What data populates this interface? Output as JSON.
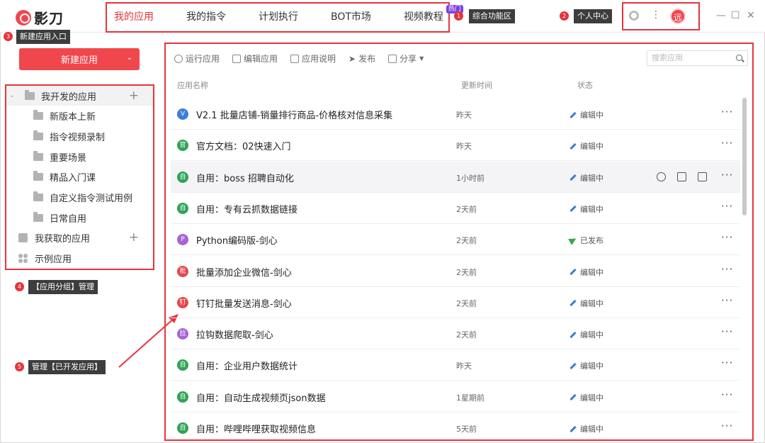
{
  "app": {
    "name": "影刀"
  },
  "nav": [
    {
      "label": "我的应用",
      "active": true
    },
    {
      "label": "我的指令"
    },
    {
      "label": "计划执行"
    },
    {
      "label": "BOT市场"
    },
    {
      "label": "视频教程",
      "badge": "热门"
    }
  ],
  "callouts": [
    {
      "num": "1",
      "label": "综合功能区"
    },
    {
      "num": "2",
      "label": "个人中心"
    },
    {
      "num": "3",
      "label": "新建应用入口"
    },
    {
      "num": "4",
      "label": "【应用分组】管理"
    },
    {
      "num": "5",
      "label": "管理【已开发应用】"
    }
  ],
  "user": {
    "avatar_text": "远"
  },
  "window_controls": {
    "minimize": "—",
    "maximize": "☐",
    "close": "✕"
  },
  "sidebar": {
    "new_button": "新建应用",
    "groups": [
      {
        "label": "我开发的应用",
        "expanded": true
      },
      {
        "label": "我获取的应用"
      },
      {
        "label": "示例应用"
      }
    ],
    "folders": [
      "新版本上新",
      "指令视频录制",
      "重要场景",
      "精品入门课",
      "自定义指令测试用例",
      "日常自用"
    ]
  },
  "toolbar": {
    "run": "运行应用",
    "edit": "编辑应用",
    "doc": "应用说明",
    "publish": "发布",
    "share": "分享"
  },
  "search": {
    "placeholder": "搜索应用"
  },
  "table": {
    "headers": {
      "name": "应用名称",
      "time": "更新时间",
      "status": "状态"
    },
    "rows": [
      {
        "badge": "V",
        "color": "#3b7ddd",
        "name": "V2.1 批量店铺-销量排行商品-价格核对信息采集",
        "time": "昨天",
        "status": "编辑中"
      },
      {
        "badge": "官",
        "color": "#2ea356",
        "name": "官方文档：02快速入门",
        "time": "昨天",
        "status": "编辑中"
      },
      {
        "badge": "自",
        "color": "#2ea356",
        "name": "自用：boss 招聘自动化",
        "time": "1小时前",
        "status": "编辑中"
      },
      {
        "badge": "自",
        "color": "#2ea356",
        "name": "自用：专有云抓数据链接",
        "time": "2天前",
        "status": "编辑中"
      },
      {
        "badge": "P",
        "color": "#a764d8",
        "name": "Python编码版-剑心",
        "time": "2天前",
        "status": "已发布"
      },
      {
        "badge": "批",
        "color": "#e5484d",
        "name": "批量添加企业微信-剑心",
        "time": "2天前",
        "status": "编辑中"
      },
      {
        "badge": "钉",
        "color": "#e5484d",
        "name": "钉钉批量发送消息-剑心",
        "time": "2天前",
        "status": "编辑中"
      },
      {
        "badge": "拉",
        "color": "#a764d8",
        "name": "拉钩数据爬取-剑心",
        "time": "2天前",
        "status": "编辑中"
      },
      {
        "badge": "自",
        "color": "#2ea356",
        "name": "自用：企业用户数据统计",
        "time": "昨天",
        "status": "编辑中"
      },
      {
        "badge": "自",
        "color": "#2ea356",
        "name": "自用：自动生成视频页json数据",
        "time": "1星期前",
        "status": "编辑中"
      },
      {
        "badge": "自",
        "color": "#2ea356",
        "name": "自用：哔哩哔哩获取视频信息",
        "time": "5天前",
        "status": "编辑中"
      }
    ]
  },
  "colors": {
    "accent": "#e5353b",
    "primary": "#f0474d"
  }
}
